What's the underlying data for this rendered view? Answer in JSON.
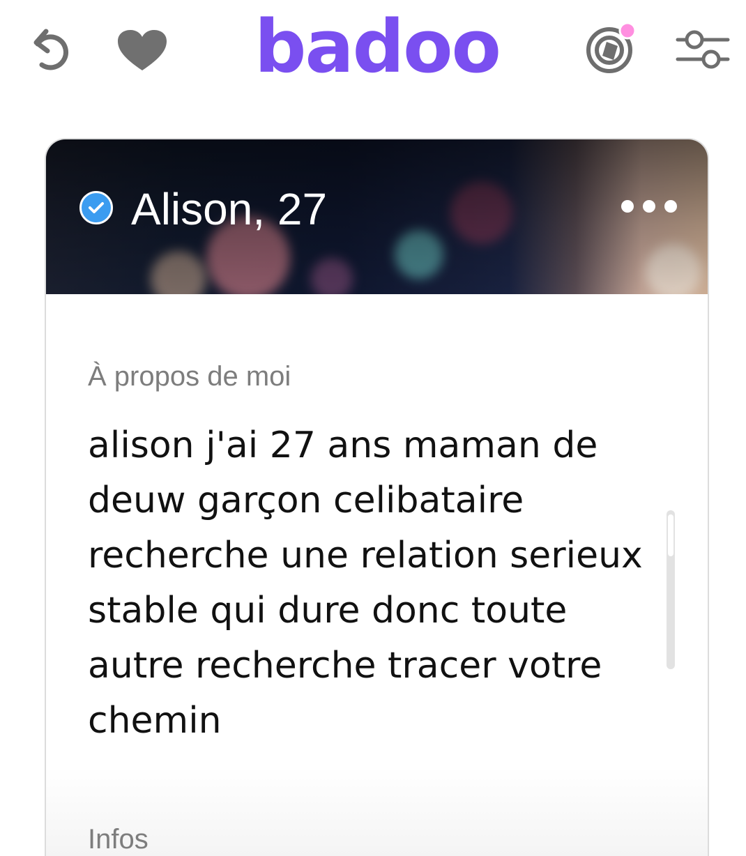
{
  "header": {
    "logo_text": "badoo",
    "brand_color": "#7a4ff0",
    "icons": {
      "undo": "undo-icon",
      "likes": "heart-icon",
      "spotlight": "spotlight-icon",
      "filters": "filter-sliders-icon"
    },
    "notification_dot_color": "#ff8fe0"
  },
  "profile": {
    "name_age": "Alison, 27",
    "verified": true,
    "verified_color": "#3b9cf0",
    "about_label": "À propos de moi",
    "about_text": "alison j'ai 27 ans maman de deuw garçon celibataire recherche une relation serieux stable qui dure donc toute autre recherche tracer votre chemin",
    "infos_label": "Infos"
  }
}
